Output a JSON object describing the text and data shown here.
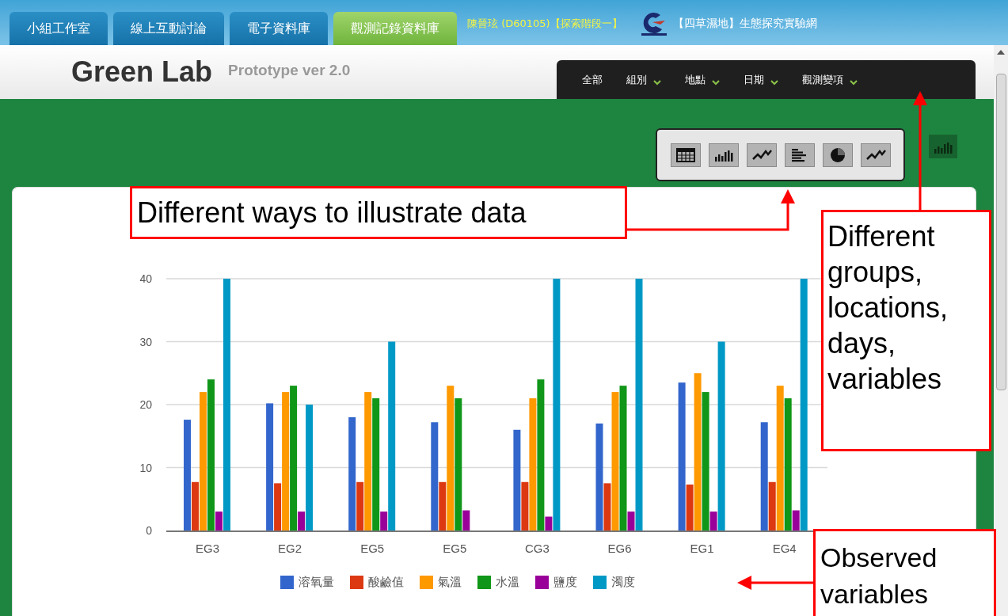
{
  "tabs": [
    {
      "label": "小組工作室",
      "selected": false
    },
    {
      "label": "線上互動討論",
      "selected": false
    },
    {
      "label": "電子資料庫",
      "selected": false
    },
    {
      "label": "觀測記錄資料庫",
      "selected": true
    }
  ],
  "user_info": "陳晉玹 (D60105)【探索階段一】",
  "site_title": "【四草濕地】生態探究實驗網",
  "app": {
    "title": "Green Lab",
    "version": "Prototype ver 2.0"
  },
  "menu": [
    {
      "label": "全部",
      "dropdown": false
    },
    {
      "label": "組別",
      "dropdown": true
    },
    {
      "label": "地點",
      "dropdown": true
    },
    {
      "label": "日期",
      "dropdown": true
    },
    {
      "label": "觀測變項",
      "dropdown": true
    }
  ],
  "chart": {
    "chart_data": {
      "type": "bar",
      "grid": true,
      "categories": [
        "EG3",
        "EG2",
        "EG5",
        "EG5",
        "CG3",
        "EG6",
        "EG1",
        "EG4"
      ],
      "ylim": [
        0,
        40
      ],
      "yticks": [
        0,
        10,
        20,
        30,
        40
      ],
      "series": [
        {
          "name": "溶氧量",
          "color": "#3366cc",
          "values": [
            17.6,
            20.2,
            18,
            17.2,
            16,
            17,
            23.5,
            17.2
          ]
        },
        {
          "name": "酸鹼值",
          "color": "#dc3912",
          "values": [
            7.7,
            7.5,
            7.7,
            7.7,
            7.7,
            7.5,
            7.3,
            7.7
          ]
        },
        {
          "name": "氣溫",
          "color": "#ff9900",
          "values": [
            22,
            22,
            22,
            23,
            21,
            22,
            25,
            23
          ]
        },
        {
          "name": "水溫",
          "color": "#109618",
          "values": [
            24,
            23,
            21,
            21,
            24,
            23,
            22,
            21
          ]
        },
        {
          "name": "鹽度",
          "color": "#990099",
          "values": [
            3,
            3,
            3,
            3.2,
            2.2,
            3,
            3,
            3.2
          ]
        },
        {
          "name": "濁度",
          "color": "#0099c6",
          "values": [
            40,
            20,
            30,
            null,
            40,
            40,
            30,
            40
          ]
        }
      ]
    }
  },
  "annotations": [
    {
      "text": "Different ways to illustrate data"
    },
    {
      "text": "Different groups, locations, days, variables"
    },
    {
      "text": "Observed variables"
    }
  ]
}
